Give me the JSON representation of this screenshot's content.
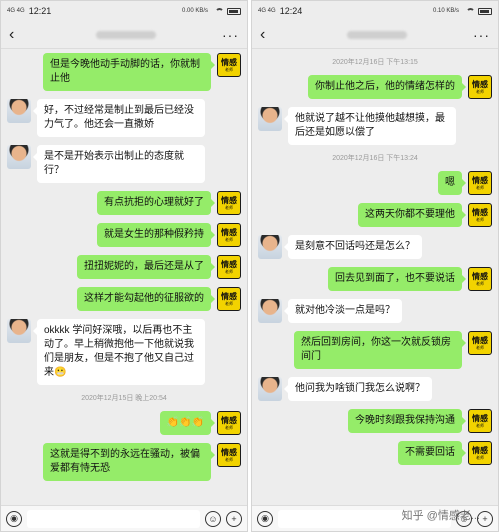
{
  "left": {
    "status": {
      "net": "4G\n4G",
      "time": "12:21",
      "speed": "0.00\nKB/s",
      "battery": ""
    },
    "messages": [
      {
        "type": "out",
        "text": "但是今晚他动手动脚的话，你就制止他"
      },
      {
        "type": "in",
        "text": "好，不过经常是制止到最后已经没力气了。他还会一直撒娇"
      },
      {
        "type": "in",
        "text": "是不是开始表示出制止的态度就行？"
      },
      {
        "type": "out",
        "text": "有点抗拒的心理就好了"
      },
      {
        "type": "out",
        "text": "就是女生的那种假矜持"
      },
      {
        "type": "out",
        "text": "扭扭妮妮的，最后还是从了"
      },
      {
        "type": "out",
        "text": "这样才能勾起他的征服欲的"
      },
      {
        "type": "in",
        "text": "okkkk 学问好深哦，以后再也不主动了。早上稍微抱他一下他就说我们是朋友，但是不抱了他又自己过来😬"
      },
      {
        "type": "time",
        "text": "2020年12月15日 晚上20:54"
      },
      {
        "type": "out",
        "text": "👏👏👏"
      },
      {
        "type": "out",
        "text": "这就是得不到的永远在骚动，被偏爱都有恃无恐"
      }
    ]
  },
  "right": {
    "status": {
      "net": "4G\n4G",
      "time": "12:24",
      "speed": "0.10\nKB/s",
      "battery": ""
    },
    "messages": [
      {
        "type": "time",
        "text": "2020年12月16日 下午13:15"
      },
      {
        "type": "out",
        "text": "你制止他之后，他的情绪怎样的"
      },
      {
        "type": "in",
        "text": "他就说了越不让他摸他越想摸，最后还是如愿以偿了"
      },
      {
        "type": "time",
        "text": "2020年12月16日 下午13:24"
      },
      {
        "type": "out",
        "text": "嗯"
      },
      {
        "type": "out",
        "text": "这两天你都不要理他"
      },
      {
        "type": "in",
        "text": "是刻意不回话吗还是怎么？"
      },
      {
        "type": "out",
        "text": "回去见到面了，也不要说话"
      },
      {
        "type": "in",
        "text": "就对他冷淡一点是吗？"
      },
      {
        "type": "out",
        "text": "然后回到房间，你这一次就反锁房间门"
      },
      {
        "type": "in",
        "text": "他问我为啥锁门我怎么说啊？"
      },
      {
        "type": "out",
        "text": "今晚时刻跟我保持沟通"
      },
      {
        "type": "out",
        "text": "不需要回话"
      }
    ],
    "watermark": "知乎 @情感老..."
  },
  "brand_avatar": {
    "line1": "情感",
    "line2": "老师"
  },
  "colors": {
    "out_bubble": "#95ec69",
    "in_bubble": "#ffffff",
    "bg": "#ededed"
  }
}
